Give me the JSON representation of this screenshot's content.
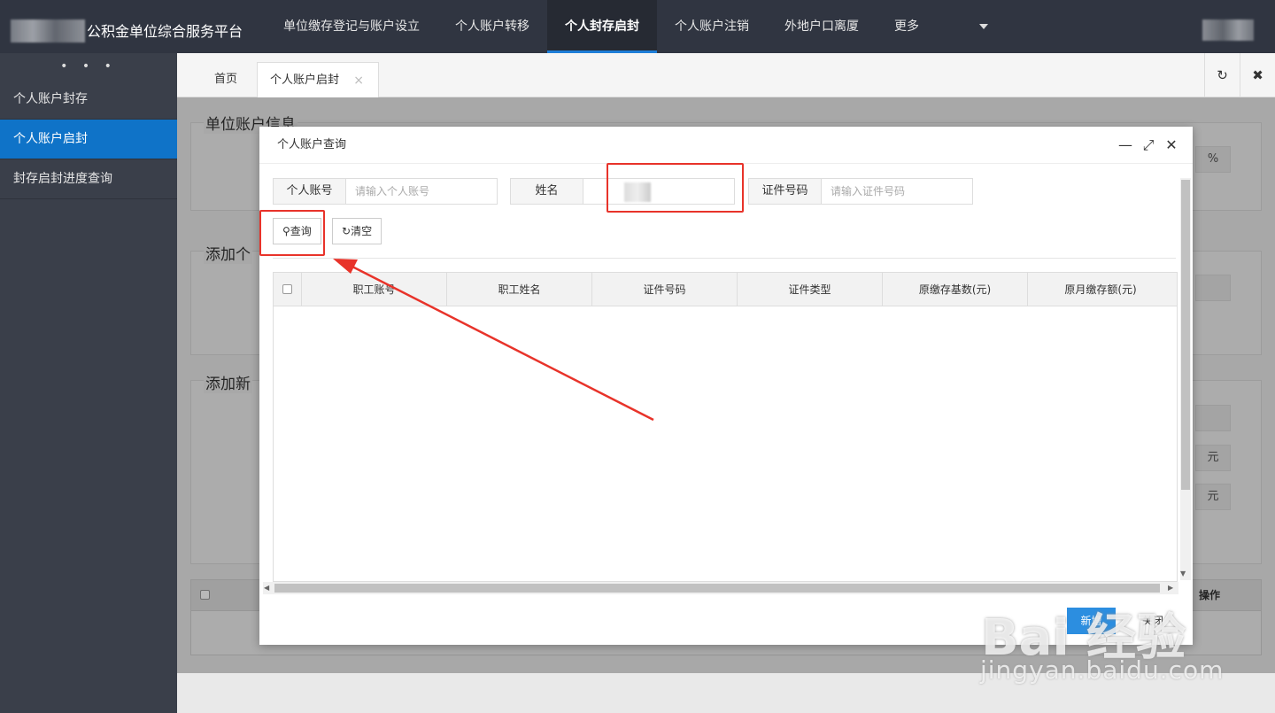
{
  "app": {
    "brand": "公积金单位综合服务平台"
  },
  "nav": {
    "items": [
      "单位缴存登记与账户设立",
      "个人账户转移",
      "个人封存启封",
      "个人账户注销",
      "外地户口离厦",
      "更多"
    ],
    "active_index": 2
  },
  "sidebar": {
    "dots": "• • •",
    "items": [
      "个人账户封存",
      "个人账户启封",
      "封存启封进度查询"
    ],
    "active_index": 1
  },
  "tabs": {
    "home": "首页",
    "active": "个人账户启封",
    "close": "×"
  },
  "toolbar": {
    "refresh": "↻",
    "close": "✖"
  },
  "background": {
    "panel1_title": "单位账户信息",
    "panel2_title": "添加个",
    "panel3_title": "添加新",
    "unit_percent": "%",
    "unit_yuan": "元",
    "table_action_header": "操作",
    "add_button": "新增",
    "close_button": "关闭"
  },
  "modal": {
    "title": "个人账户查询",
    "controls": {
      "minimize": "—",
      "maximize": "⤢",
      "close": "✕"
    },
    "fields": {
      "account_label": "个人账号",
      "account_placeholder": "请输入个人账号",
      "name_label": "姓名",
      "name_value": "",
      "id_label": "证件号码",
      "id_placeholder": "请输入证件号码"
    },
    "buttons": {
      "query": "查询",
      "clear": "清空"
    },
    "columns": [
      "职工账号",
      "职工姓名",
      "证件号码",
      "证件类型",
      "原缴存基数(元)",
      "原月缴存额(元)"
    ]
  },
  "watermark": {
    "brand": "Bai 经验",
    "url": "jingyan.baidu.com"
  },
  "colors": {
    "topbar": "#303541",
    "sidebar": "#3a3f4a",
    "active": "#0f73c8",
    "annotation": "#e8332a"
  }
}
